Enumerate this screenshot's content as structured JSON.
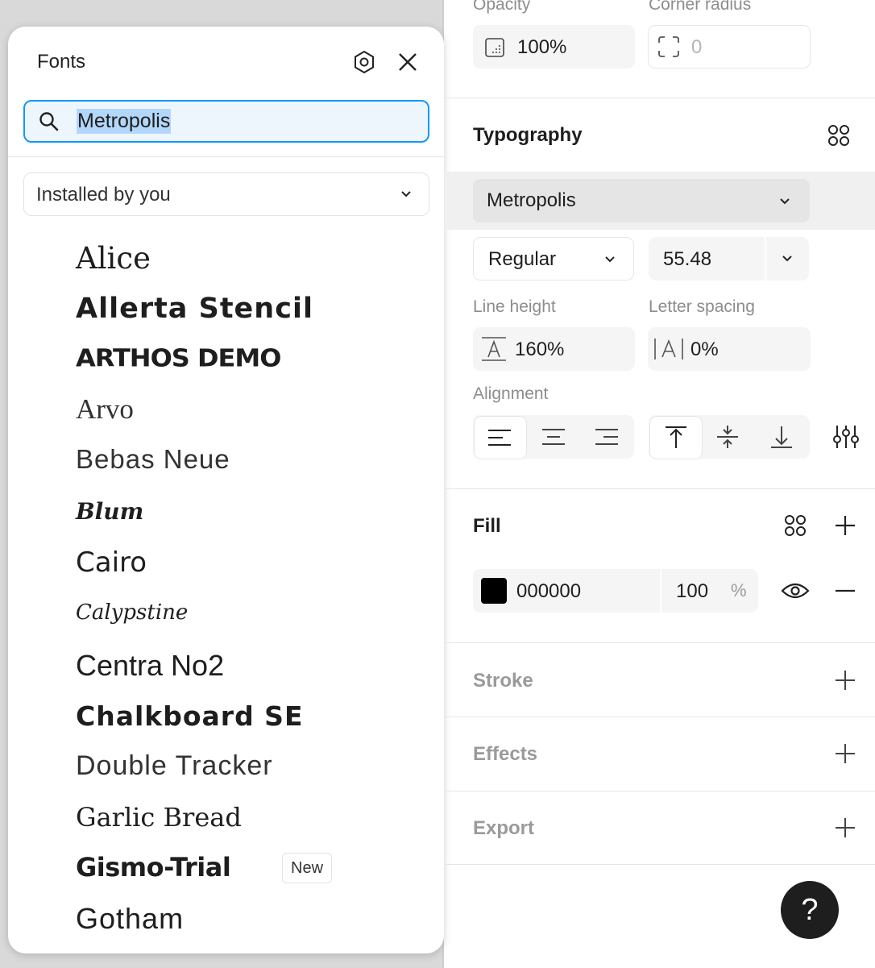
{
  "fonts_panel": {
    "title": "Fonts",
    "search_value": "Metropolis",
    "filter": "Installed by you",
    "fonts": [
      "Alice",
      "Allerta Stencil",
      "ARTHOS DEMO",
      "Arvo",
      "Bebas Neue",
      "Blum",
      "Cairo",
      "Calypstine",
      "Centra No2",
      "Chalkboard SE",
      "Double Tracker",
      "Garlic Bread",
      "Gismo-Trial",
      "Gotham"
    ],
    "new_badge": "New"
  },
  "properties": {
    "opacity_label": "Opacity",
    "opacity_value": "100%",
    "corner_radius_label": "Corner radius",
    "corner_radius_value": "0",
    "typography": {
      "title": "Typography",
      "font_family": "Metropolis",
      "font_weight": "Regular",
      "font_size": "55.48",
      "line_height_label": "Line height",
      "line_height_value": "160%",
      "letter_spacing_label": "Letter spacing",
      "letter_spacing_value": "0%",
      "alignment_label": "Alignment"
    },
    "fill": {
      "title": "Fill",
      "hex": "000000",
      "opacity": "100",
      "percent": "%",
      "color": "#000000"
    },
    "stroke_title": "Stroke",
    "effects_title": "Effects",
    "export_title": "Export",
    "help": "?"
  }
}
